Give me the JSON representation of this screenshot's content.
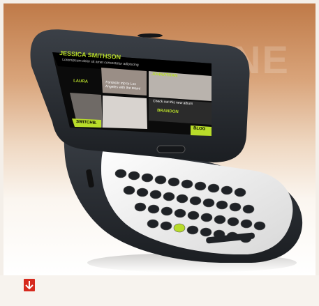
{
  "colors": {
    "background_top": "#bf7a48",
    "background_bottom": "#ffffff",
    "phone_body": "#2b2f35",
    "keyboard_base": "#f2f2f2",
    "key": "#1f2226",
    "screen_header": "#000000",
    "accent_green": "#b8dc2a",
    "badge_red": "#d62a1e"
  },
  "background_text": "ONNE",
  "screen": {
    "header_name": "JESSICA SMITHSON",
    "header_sub": "Loremipsum dolor sit amet consectetur adipiscing",
    "tile_1_label": "LAURA",
    "tile_1_text": "Fantastic trip to Los Angeles with the team!",
    "tile_2_label": "JOHNATHAN",
    "tile_3_label": "BRANDON",
    "tile_3_text": "Check out this new album",
    "footer_left": "SWITCHB.",
    "footer_right": "BLOG"
  },
  "icons": {
    "badge": "download-arrow-icon"
  }
}
